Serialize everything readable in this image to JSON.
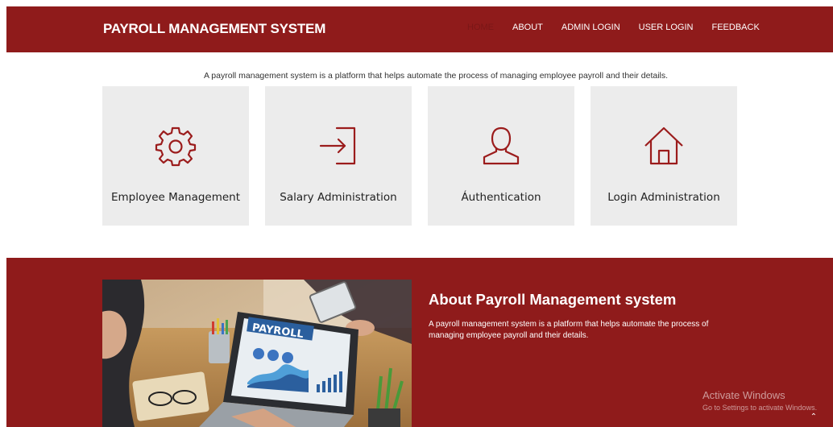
{
  "header": {
    "brand": "PAYROLL MANAGEMENT SYSTEM",
    "nav": [
      "HOME",
      "ABOUT",
      "ADMIN LOGIN",
      "USER LOGIN",
      "FEEDBACK"
    ]
  },
  "intro": "A payroll management system is a platform that helps automate the process of managing employee payroll and their details.",
  "features": [
    {
      "title": "Employee Management",
      "icon": "gear-icon"
    },
    {
      "title": "Salary Administration",
      "icon": "login-icon"
    },
    {
      "title": "Áuthentication",
      "icon": "user-icon"
    },
    {
      "title": "Login Administration",
      "icon": "home-icon"
    }
  ],
  "about": {
    "title": "About Payroll Management system",
    "text": "A payroll management system is a platform that helps automate the process of managing employee payroll and their details.",
    "image_label": "PAYROLL"
  },
  "watermark": {
    "line1": "Activate Windows",
    "line2": "Go to Settings to activate Windows."
  },
  "colors": {
    "primary": "#8f1b1b",
    "card": "#ececec",
    "icon": "#9b1c1c"
  }
}
